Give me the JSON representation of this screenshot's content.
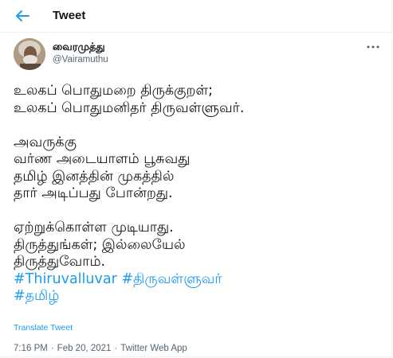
{
  "header": {
    "title": "Tweet",
    "back_icon": "arrow-left-icon"
  },
  "author": {
    "name": "வைரமுத்து",
    "handle": "@Vairamuthu"
  },
  "tweet": {
    "lines": [
      "உலகப் பொதுமறை திருக்குறள்;",
      "உலகப் பொதுமனிதர் திருவள்ளுவர்.",
      "",
      "அவருக்கு",
      "வர்ண அடையாளம் பூசுவது",
      "தமிழ் இனத்தின் முகத்தில்",
      "தார் அடிப்பது போன்றது.",
      "",
      "ஏற்றுக்கொள்ள முடியாது.",
      "திருத்துங்கள்; இல்லையேல்",
      "திருத்துவோம்."
    ],
    "hashtags": [
      "#Thiruvalluvar",
      "#திருவள்ளுவர்",
      "#தமிழ்"
    ]
  },
  "translate_label": "Translate Tweet",
  "meta": {
    "time": "7:16 PM",
    "date": "Feb 20, 2021",
    "source": "Twitter Web App",
    "separator": "·"
  },
  "colors": {
    "accent": "#1d9bf0",
    "text": "#0f1419",
    "secondary": "#536471",
    "border": "#eff3f4"
  }
}
